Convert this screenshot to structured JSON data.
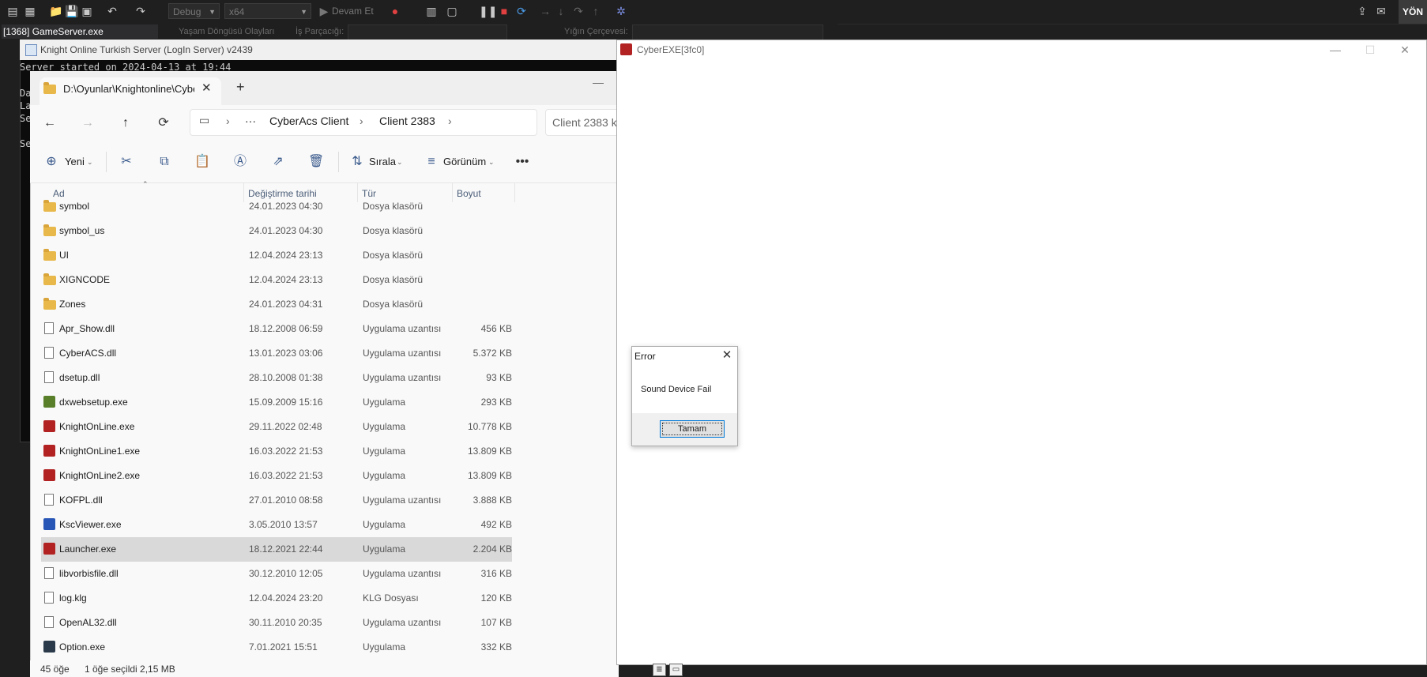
{
  "vs_toolbar": {
    "config": "Debug",
    "platform": "x64",
    "continue_label": "Devam Et",
    "process": "[1368] GameServer.exe",
    "lifecycle_label": "Yaşam Döngüsü Olayları",
    "thread_label": "İş Parçacığı:",
    "stack_label": "Yığın Çerçevesi:",
    "account_label": "YÖN"
  },
  "console": {
    "title": "Knight Online Turkish Server (LogIn  Server) v2439",
    "lines": [
      "Server started on 2024-04-13 at 19:44",
      "Da",
      "La",
      "Se",
      "Se"
    ]
  },
  "explorer": {
    "tab_title": "D:\\Oyunlar\\Knightonline\\Cybe",
    "breadcrumb": [
      "CyberAcs Client",
      "Client 2383"
    ],
    "search_placeholder": "Client 2383 k",
    "commands": {
      "new": "Yeni",
      "sort": "Sırala",
      "view": "Görünüm"
    },
    "columns": {
      "name": "Ad",
      "date": "Değiştirme tarihi",
      "type": "Tür",
      "size": "Boyut"
    },
    "files": [
      {
        "name": "symbol",
        "date": "24.01.2023 04:30",
        "type": "Dosya klasörü",
        "size": "",
        "icon": "folder"
      },
      {
        "name": "symbol_us",
        "date": "24.01.2023 04:30",
        "type": "Dosya klasörü",
        "size": "",
        "icon": "folder"
      },
      {
        "name": "UI",
        "date": "12.04.2024 23:13",
        "type": "Dosya klasörü",
        "size": "",
        "icon": "folder"
      },
      {
        "name": "XIGNCODE",
        "date": "12.04.2024 23:13",
        "type": "Dosya klasörü",
        "size": "",
        "icon": "folder"
      },
      {
        "name": "Zones",
        "date": "24.01.2023 04:31",
        "type": "Dosya klasörü",
        "size": "",
        "icon": "folder"
      },
      {
        "name": "Apr_Show.dll",
        "date": "18.12.2008 06:59",
        "type": "Uygulama uzantısı",
        "size": "456 KB",
        "icon": "file"
      },
      {
        "name": "CyberACS.dll",
        "date": "13.01.2023 03:06",
        "type": "Uygulama uzantısı",
        "size": "5.372 KB",
        "icon": "file"
      },
      {
        "name": "dsetup.dll",
        "date": "28.10.2008 01:38",
        "type": "Uygulama uzantısı",
        "size": "93 KB",
        "icon": "file"
      },
      {
        "name": "dxwebsetup.exe",
        "date": "15.09.2009 15:16",
        "type": "Uygulama",
        "size": "293 KB",
        "icon": "exe-green"
      },
      {
        "name": "KnightOnLine.exe",
        "date": "29.11.2022 02:48",
        "type": "Uygulama",
        "size": "10.778 KB",
        "icon": "exe"
      },
      {
        "name": "KnightOnLine1.exe",
        "date": "16.03.2022 21:53",
        "type": "Uygulama",
        "size": "13.809 KB",
        "icon": "exe"
      },
      {
        "name": "KnightOnLine2.exe",
        "date": "16.03.2022 21:53",
        "type": "Uygulama",
        "size": "13.809 KB",
        "icon": "exe"
      },
      {
        "name": "KOFPL.dll",
        "date": "27.01.2010 08:58",
        "type": "Uygulama uzantısı",
        "size": "3.888 KB",
        "icon": "file"
      },
      {
        "name": "KscViewer.exe",
        "date": "3.05.2010 13:57",
        "type": "Uygulama",
        "size": "492 KB",
        "icon": "exe-blue"
      },
      {
        "name": "Launcher.exe",
        "date": "18.12.2021 22:44",
        "type": "Uygulama",
        "size": "2.204 KB",
        "icon": "exe",
        "selected": true
      },
      {
        "name": "libvorbisfile.dll",
        "date": "30.12.2010 12:05",
        "type": "Uygulama uzantısı",
        "size": "316 KB",
        "icon": "file"
      },
      {
        "name": "log.klg",
        "date": "12.04.2024 23:20",
        "type": "KLG Dosyası",
        "size": "120 KB",
        "icon": "file"
      },
      {
        "name": "OpenAL32.dll",
        "date": "30.11.2010 20:35",
        "type": "Uygulama uzantısı",
        "size": "107 KB",
        "icon": "file"
      },
      {
        "name": "Option.exe",
        "date": "7.01.2021 15:51",
        "type": "Uygulama",
        "size": "332 KB",
        "icon": "exe-dark"
      }
    ],
    "status": {
      "count": "45 öğe",
      "selection": "1 öğe seçildi  2,15 MB"
    }
  },
  "cyber_window": {
    "title": "CyberEXE[3fc0]"
  },
  "error_dialog": {
    "title": "Error",
    "message": "Sound Device Fail",
    "ok_label": "Tamam"
  }
}
